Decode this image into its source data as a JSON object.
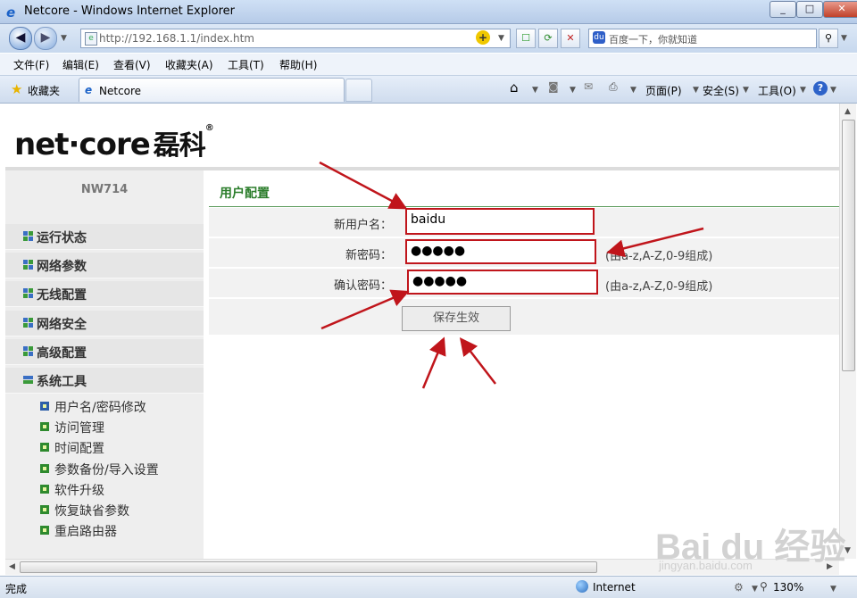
{
  "browser": {
    "window_title": "Netcore - Windows Internet Explorer",
    "url": "http://192.168.1.1/index.htm",
    "search_placeholder": "百度一下，你就知道",
    "menu": [
      "文件(F)",
      "编辑(E)",
      "查看(V)",
      "收藏夹(A)",
      "工具(T)",
      "帮助(H)"
    ],
    "favorites_label": "收藏夹",
    "tab_title": "Netcore",
    "commands": {
      "page": "页面(P)",
      "safety": "安全(S)",
      "tools": "工具(O)"
    },
    "status": {
      "text": "完成",
      "zone": "Internet",
      "zoom": "130%"
    }
  },
  "router": {
    "logo_text": "net·core",
    "logo_cn": "磊科",
    "model": "NW714",
    "nav": [
      "运行状态",
      "网络参数",
      "无线配置",
      "网络安全",
      "高级配置",
      "系统工具"
    ],
    "sub_items": [
      "用户名/密码修改",
      "访问管理",
      "时间配置",
      "参数备份/导入设置",
      "软件升级",
      "恢复缺省参数",
      "重启路由器"
    ],
    "panel_title": "用户配置",
    "form": {
      "username_label": "新用户名：",
      "username_value": "baidu",
      "password_label": "新密码：",
      "password_value": "●●●●●",
      "password_hint": "(由a-z,A-Z,0-9组成)",
      "confirm_label": "确认密码：",
      "confirm_value": "●●●●●",
      "confirm_hint": "(由a-z,A-Z,0-9组成)",
      "save_label": "保存生效"
    }
  },
  "watermark": {
    "text": "Bai du 经验",
    "url": "jingyan.baidu.com"
  },
  "colors": {
    "annotation_red": "#c0151b",
    "title_green": "#2b7d2b"
  }
}
